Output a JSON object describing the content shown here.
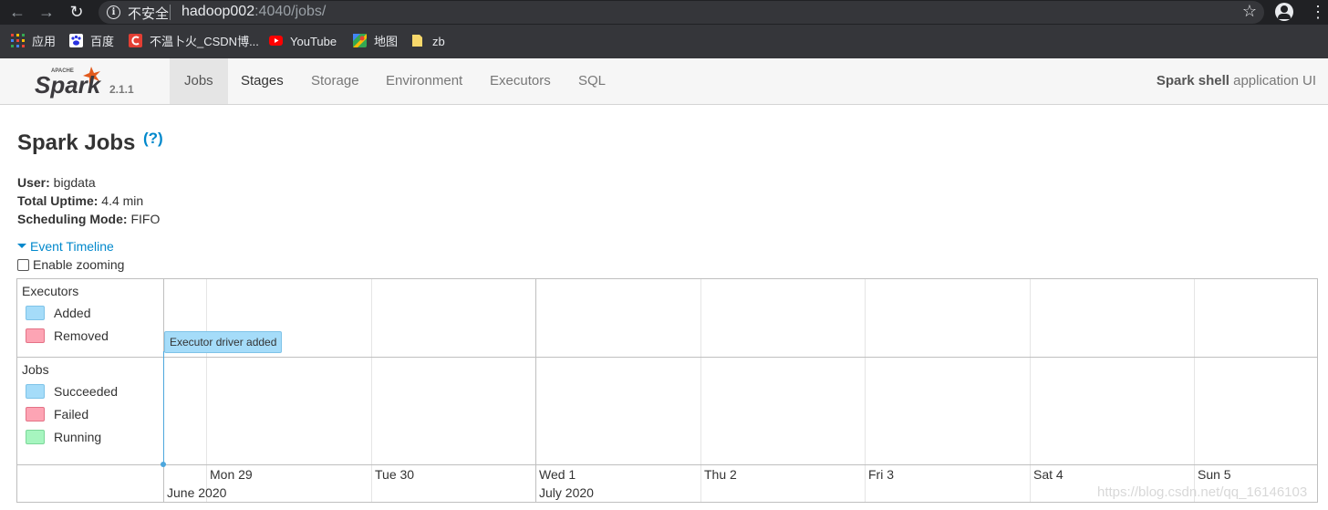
{
  "browser": {
    "security_label": "不安全",
    "url_host": "hadoop002",
    "url_rest": ":4040/jobs/",
    "bookmarks": [
      {
        "label": "应用",
        "icon": "apps-grid-icon"
      },
      {
        "label": "百度",
        "icon": "baidu-paw-icon"
      },
      {
        "label": "不温卜火_CSDN博...",
        "icon": "csdn-c-icon"
      },
      {
        "label": "YouTube",
        "icon": "youtube-icon"
      },
      {
        "label": "地图",
        "icon": "maps-icon"
      },
      {
        "label": "zb",
        "icon": "folder-icon"
      }
    ]
  },
  "spark_nav": {
    "logo_top_text": "APACHE",
    "logo_text": "Spark",
    "version": "2.1.1",
    "tabs": [
      "Jobs",
      "Stages",
      "Storage",
      "Environment",
      "Executors",
      "SQL"
    ],
    "active_tab": "Jobs",
    "app_name_bold": "Spark shell",
    "app_name_rest": " application UI"
  },
  "page": {
    "title": "Spark Jobs",
    "help": "(?)",
    "user_label": "User:",
    "user_value": " bigdata",
    "uptime_label": "Total Uptime:",
    "uptime_value": " 4.4 min",
    "sched_label": "Scheduling Mode:",
    "sched_value": " FIFO",
    "event_timeline": "Event Timeline",
    "enable_zooming": "Enable zooming"
  },
  "timeline": {
    "executors_group": {
      "title": "Executors",
      "legend": [
        {
          "label": "Added",
          "color": "#a5dcf9"
        },
        {
          "label": "Removed",
          "color": "#fda4b4"
        }
      ]
    },
    "jobs_group": {
      "title": "Jobs",
      "legend": [
        {
          "label": "Succeeded",
          "color": "#a5dcf9"
        },
        {
          "label": "Failed",
          "color": "#fda4b4"
        },
        {
          "label": "Running",
          "color": "#a6f5bf"
        }
      ]
    },
    "event": "Executor driver added",
    "minor_labels": [
      "Mon 29",
      "Tue 30",
      "Wed 1",
      "Thu 2",
      "Fri 3",
      "Sat 4",
      "Sun 5"
    ],
    "major_labels": [
      "June 2020",
      "July 2020"
    ]
  },
  "watermark": "https://blog.csdn.net/qq_16146103"
}
